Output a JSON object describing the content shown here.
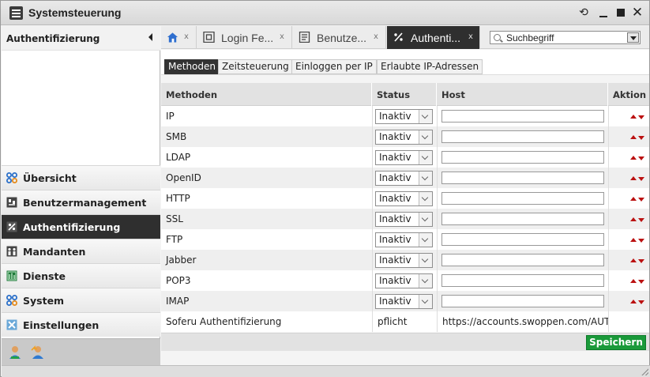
{
  "window": {
    "title": "Systemsteuerung"
  },
  "sidebar": {
    "header": "Authentifizierung",
    "items": [
      {
        "label": "Übersicht",
        "icon": "overview-icon",
        "active": false
      },
      {
        "label": "Benutzermanagement",
        "icon": "users-management-icon",
        "active": false
      },
      {
        "label": "Authentifizierung",
        "icon": "authentication-icon",
        "active": true
      },
      {
        "label": "Mandanten",
        "icon": "tenants-icon",
        "active": false
      },
      {
        "label": "Dienste",
        "icon": "services-icon",
        "active": false
      },
      {
        "label": "System",
        "icon": "system-icon",
        "active": false
      },
      {
        "label": "Einstellungen",
        "icon": "settings-icon",
        "active": false
      }
    ]
  },
  "tabs": [
    {
      "label": "",
      "icon": "home-icon",
      "close": "x",
      "active": false
    },
    {
      "label": "Login Fe...",
      "icon": "login-icon",
      "close": "x",
      "active": false
    },
    {
      "label": "Benutze...",
      "icon": "document-icon",
      "close": "x",
      "active": false
    },
    {
      "label": "Authenti...",
      "icon": "authentication-icon",
      "close": "x",
      "active": true
    }
  ],
  "search": {
    "value": "Suchbegriff"
  },
  "subtabs": [
    {
      "label": "Methoden",
      "active": true
    },
    {
      "label": "Zeitsteuerung",
      "active": false
    },
    {
      "label": "Einloggen per IP",
      "active": false
    },
    {
      "label": "Erlaubte IP-Adressen",
      "active": false
    }
  ],
  "table": {
    "headers": {
      "method": "Methoden",
      "status": "Status",
      "host": "Host",
      "action": "Aktion"
    },
    "rows": [
      {
        "method": "IP",
        "status": "Inaktiv"
      },
      {
        "method": "SMB",
        "status": "Inaktiv"
      },
      {
        "method": "LDAP",
        "status": "Inaktiv"
      },
      {
        "method": "OpenID",
        "status": "Inaktiv"
      },
      {
        "method": "HTTP",
        "status": "Inaktiv"
      },
      {
        "method": "SSL",
        "status": "Inaktiv"
      },
      {
        "method": "FTP",
        "status": "Inaktiv"
      },
      {
        "method": "Jabber",
        "status": "Inaktiv"
      },
      {
        "method": "POP3",
        "status": "Inaktiv"
      },
      {
        "method": "IMAP",
        "status": "Inaktiv"
      }
    ],
    "last_row": {
      "method": "Soferu Authentifizierung",
      "status": "pflicht",
      "host": "https://accounts.swoppen.com/AUT"
    }
  },
  "save_label": "Speichern",
  "colors": {
    "accent_dark": "#2f2f2f",
    "save_green": "#1a9a3a",
    "arrow_red": "#bb1111"
  }
}
